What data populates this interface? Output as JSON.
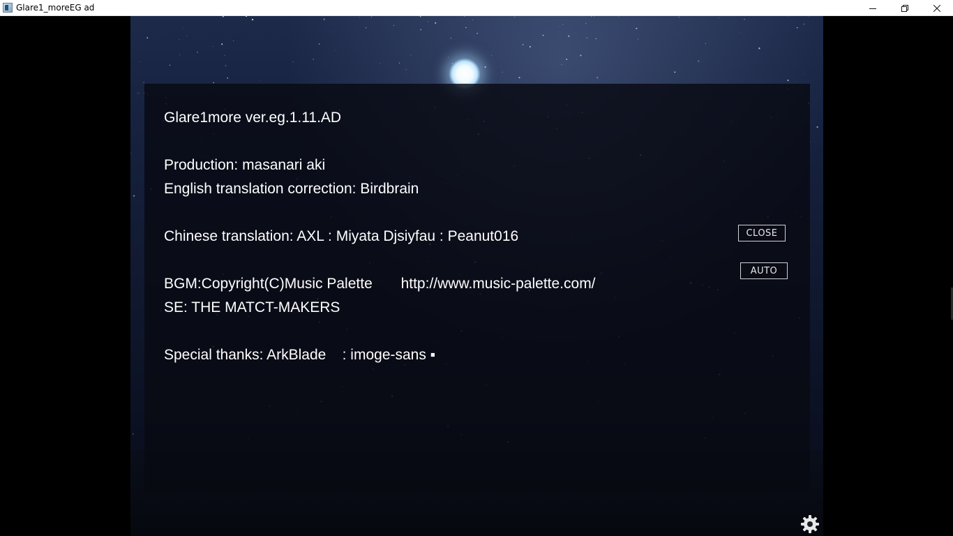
{
  "window": {
    "title": "Glare1_moreEG ad"
  },
  "credits": {
    "version": "Glare1more ver.eg.1.11.AD",
    "production": "Production: masanari aki",
    "english": "English translation correction: Birdbrain",
    "chinese": "Chinese translation: AXL : Miyata Djsiyfau : Peanut016",
    "bgm": "BGM:Copyright(C)Music Palette       http://www.music-palette.com/",
    "se": "SE: THE MATCT-MAKERS",
    "thanks": "Special thanks: ArkBlade    : imoge-sans ▪"
  },
  "buttons": {
    "close": "CLOSE",
    "auto": "AUTO"
  },
  "icons": {
    "settings": "gear-icon",
    "moon": "moon-icon"
  },
  "colors": {
    "text": "#ffffff",
    "panel": "#080a12",
    "sky_top": "#1d2a4a"
  }
}
